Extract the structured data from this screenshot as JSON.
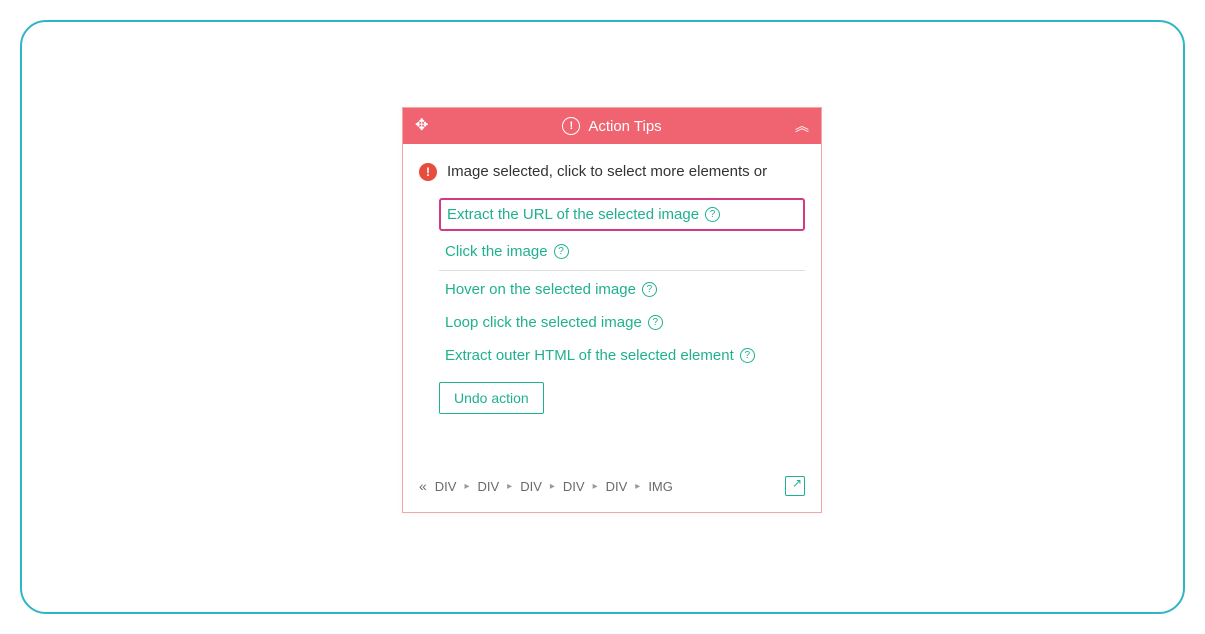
{
  "panel": {
    "title": "Action Tips",
    "status_text": "Image selected, click to select more elements or",
    "actions": {
      "extract_url": "Extract the URL of the selected image",
      "click_image": "Click the image",
      "hover_image": "Hover on the selected image",
      "loop_click": "Loop click the selected image",
      "extract_outer_html": "Extract outer HTML of the selected element"
    },
    "undo_label": "Undo action",
    "breadcrumb": {
      "items": [
        "DIV",
        "DIV",
        "DIV",
        "DIV",
        "DIV",
        "IMG"
      ]
    }
  }
}
